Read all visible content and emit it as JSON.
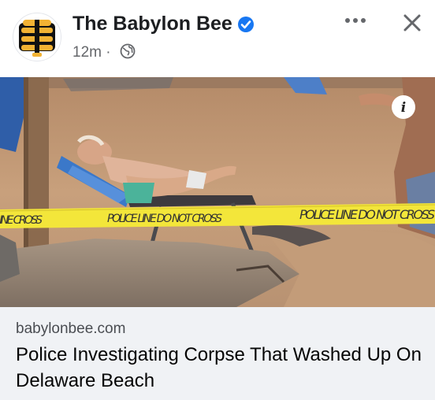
{
  "post": {
    "page_name": "The Babylon Bee",
    "timestamp": "12m",
    "separator": "·",
    "privacy_icon": "globe-icon",
    "more_icon": "more-horizontal-icon",
    "close_icon": "close-icon",
    "verified_icon": "verified-badge-icon",
    "verified_color": "#1877f2"
  },
  "photo": {
    "info_icon": "info-icon",
    "tape_text": "POLICE LINE DO NOT CROSS",
    "tape_color": "#f3e63a"
  },
  "link_preview": {
    "domain": "babylonbee.com",
    "headline": "Police Investigating Corpse That Washed Up On Delaware Beach"
  },
  "colors": {
    "card_bg": "#f0f2f5",
    "secondary_text": "#65676b",
    "primary_text": "#050505"
  }
}
